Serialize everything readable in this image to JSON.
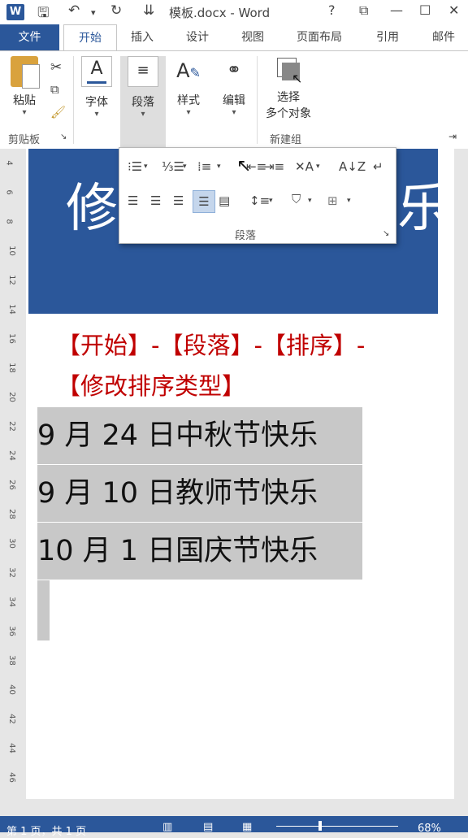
{
  "window": {
    "title": "模板.docx - Word",
    "help": "?",
    "minimize": "—",
    "maximize": "☐",
    "close": "✕"
  },
  "tabs": {
    "file": "文件",
    "home": "开始",
    "insert": "插入",
    "design": "设计",
    "view": "视图",
    "layout": "页面布局",
    "references": "引用",
    "mailings": "邮件"
  },
  "ribbon": {
    "paste": "粘贴",
    "clipboard_group": "剪贴板",
    "font": "字体",
    "paragraph": "段落",
    "styles": "样式",
    "editing": "编辑",
    "select_line1": "选择",
    "select_line2": "多个对象",
    "new_group": "新建组"
  },
  "ruler": [
    "4",
    "6",
    "8",
    "10",
    "12",
    "14",
    "16",
    "18",
    "20",
    "22",
    "24",
    "26",
    "28",
    "30",
    "32",
    "34",
    "36",
    "38",
    "40",
    "42",
    "44",
    "46"
  ],
  "banner": {
    "left_char": "修",
    "right_char": "乐"
  },
  "paragraph_popup": {
    "label": "段落"
  },
  "document": {
    "instruction_line1": "【开始】-【段落】-【排序】-",
    "instruction_line2": "【修改排序类型】",
    "lines": [
      "9 月 24 日中秋节快乐",
      "9 月 10 日教师节快乐",
      "10 月 1 日国庆节快乐"
    ]
  },
  "status": {
    "page": "第 1 页，共 1 页",
    "zoom": "68%"
  }
}
